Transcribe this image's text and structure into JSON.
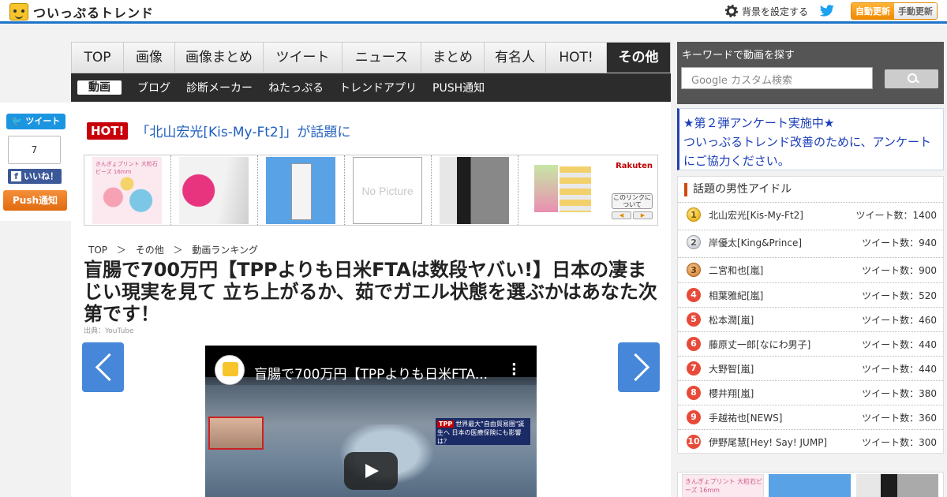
{
  "header": {
    "logo_text": "ついっぷるトレンド",
    "settings_label": "背景を設定する",
    "auto_update": "自動更新",
    "manual_update": "手動更新"
  },
  "share": {
    "tweet_label": "ツイート",
    "count": "7",
    "like_label": "いいね！",
    "push_label": "Push通知"
  },
  "nav": {
    "tabs": [
      "TOP",
      "画像",
      "画像まとめ",
      "ツイート",
      "ニュース",
      "まとめ",
      "有名人",
      "HOT!",
      "その他"
    ],
    "subtabs": [
      "動画",
      "ブログ",
      "診断メーカー",
      "ねたっぷる",
      "トレンドアプリ",
      "PUSH通知"
    ]
  },
  "hot": {
    "badge": "HOT!",
    "text": "「北山宏光[Kis-My-Ft2]」が話題に"
  },
  "ads": {
    "t1_label": "きんぎょプリント 大粒石ビーズ 16mm",
    "no_picture": "No Picture",
    "rakuten": "Rakuten",
    "link_note": "このリンクについて"
  },
  "breadcrumb": [
    "TOP",
    "＞",
    "その他",
    "＞",
    "動画ランキング"
  ],
  "article": {
    "title": "盲腸で700万円【TPPよりも日米FTAは数段ヤバい!】日本の凄まじい現実を見て 立ち上がるか、茹でガエル状態を選ぶかはあなた次第です！",
    "source": "出典：YouTube",
    "video_title": "盲腸で700万円【TPPよりも日米FTA...",
    "video_tag_red": "TPP",
    "video_tag": "世界最大\"自由貿易圏\"誕生へ 日本の医療保険にも影響は？"
  },
  "sidebar": {
    "search_title": "キーワードで動画を探す",
    "search_placeholder": "Google カスタム検索",
    "enquete_line1": "★第２弾アンケート実施中★",
    "enquete_line2": "ついっぷるトレンド改善のために、アンケートにご協力ください。",
    "ranking_title": "話題の男性アイドル",
    "ranking": [
      {
        "no": "1",
        "name": "北山宏光[Kis-My-Ft2]",
        "tweets": "ツイート数：1400"
      },
      {
        "no": "2",
        "name": "岸優太[King&Prince]",
        "tweets": "ツイート数：940"
      },
      {
        "no": "3",
        "name": "二宮和也[嵐]",
        "tweets": "ツイート数：900"
      },
      {
        "no": "4",
        "name": "相葉雅紀[嵐]",
        "tweets": "ツイート数：520"
      },
      {
        "no": "5",
        "name": "松本潤[嵐]",
        "tweets": "ツイート数：460"
      },
      {
        "no": "6",
        "name": "藤原丈一郎[なにわ男子]",
        "tweets": "ツイート数：440"
      },
      {
        "no": "7",
        "name": "大野智[嵐]",
        "tweets": "ツイート数：440"
      },
      {
        "no": "8",
        "name": "櫻井翔[嵐]",
        "tweets": "ツイート数：380"
      },
      {
        "no": "9",
        "name": "手越祐也[NEWS]",
        "tweets": "ツイート数：360"
      },
      {
        "no": "10",
        "name": "伊野尾慧[Hey! Say! JUMP]",
        "tweets": "ツイート数：300"
      }
    ],
    "thumb1_label": "きんぎょプリント 大粒石ビーズ 16mm"
  },
  "colors": {
    "accent": "#1f74c9",
    "hot": "#c8000a",
    "nav_dark": "#2c2c2c",
    "link": "#1a3cb8"
  }
}
